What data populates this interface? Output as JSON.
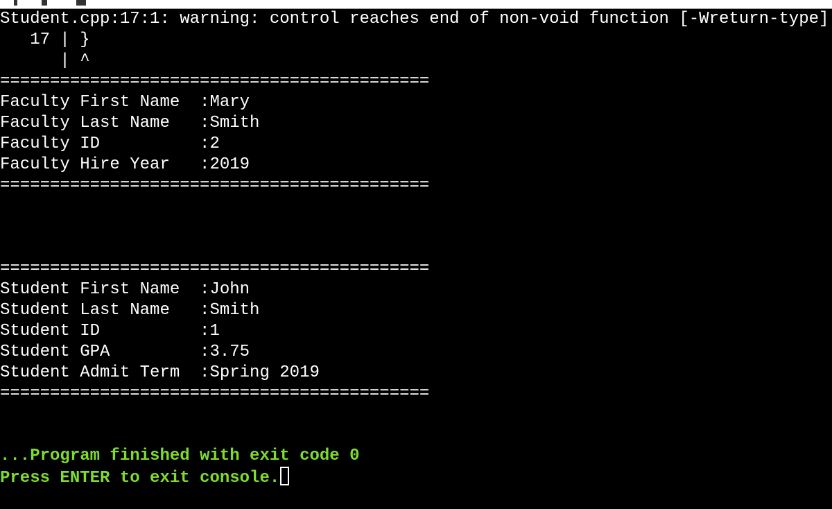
{
  "toolbar": {
    "icons": [
      "dropdown-icon",
      "debug-icon",
      "run-icon"
    ]
  },
  "terminal": {
    "warning": "Student.cpp:17:1: warning: control reaches end of non-void function [-Wreturn-type]",
    "source_line": "   17 | }",
    "caret_line": "      | ^",
    "separator": "===========================================",
    "faculty": [
      {
        "label": "Faculty First Name  ",
        "value": ":Mary"
      },
      {
        "label": "Faculty Last Name   ",
        "value": ":Smith"
      },
      {
        "label": "Faculty ID          ",
        "value": ":2"
      },
      {
        "label": "Faculty Hire Year   ",
        "value": ":2019"
      }
    ],
    "student": [
      {
        "label": "Student First Name  ",
        "value": ":John"
      },
      {
        "label": "Student Last Name   ",
        "value": ":Smith"
      },
      {
        "label": "Student ID          ",
        "value": ":1"
      },
      {
        "label": "Student GPA         ",
        "value": ":3.75"
      },
      {
        "label": "Student Admit Term  ",
        "value": ":Spring 2019"
      }
    ],
    "finished": "...Program finished with exit code 0",
    "press_enter": "Press ENTER to exit console.",
    "status_color": "#7fdc2e"
  }
}
